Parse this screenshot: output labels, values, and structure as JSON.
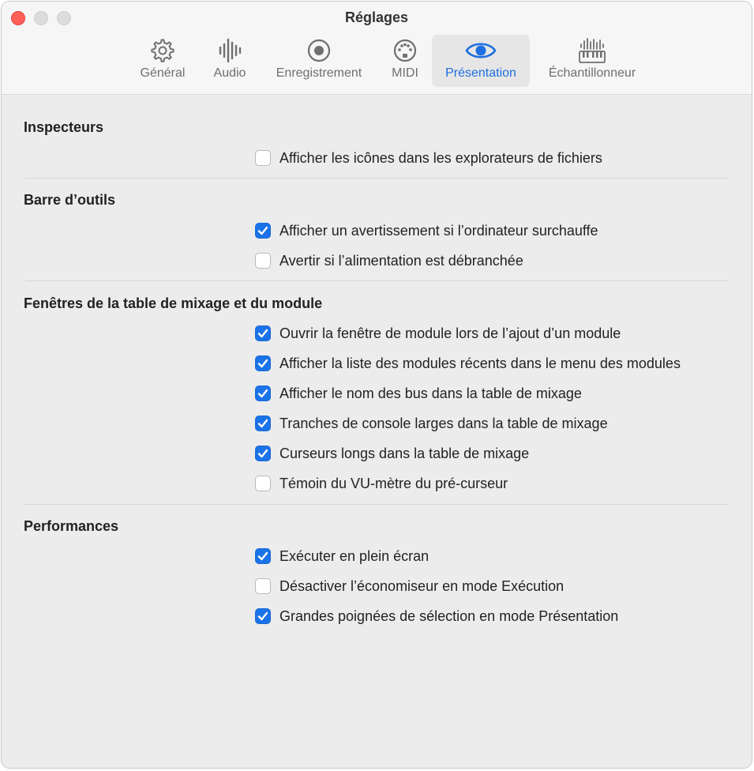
{
  "window": {
    "title": "Réglages"
  },
  "toolbar": {
    "tabs": [
      {
        "label": "Général",
        "icon": "gear-icon",
        "active": false
      },
      {
        "label": "Audio",
        "icon": "waveform-icon",
        "active": false
      },
      {
        "label": "Enregistrement",
        "icon": "record-icon",
        "active": false
      },
      {
        "label": "MIDI",
        "icon": "midi-port-icon",
        "active": false
      },
      {
        "label": "Présentation",
        "icon": "eye-icon",
        "active": true
      },
      {
        "label": "Échantillonneur",
        "icon": "sampler-keyboard-icon",
        "active": false
      }
    ]
  },
  "accent_color": "#1a73e8",
  "sections": [
    {
      "title": "Inspecteurs",
      "options": [
        {
          "label": "Afficher les icônes dans les explorateurs de fichiers",
          "checked": false
        }
      ]
    },
    {
      "title": "Barre d’outils",
      "options": [
        {
          "label": "Afficher un avertissement si l’ordinateur surchauffe",
          "checked": true
        },
        {
          "label": "Avertir si l’alimentation est débranchée",
          "checked": false
        }
      ]
    },
    {
      "title": "Fenêtres de la table de mixage et du module",
      "options": [
        {
          "label": "Ouvrir la fenêtre de module lors de l’ajout d’un module",
          "checked": true
        },
        {
          "label": "Afficher la liste des modules récents dans le menu des modules",
          "checked": true
        },
        {
          "label": "Afficher le nom des bus dans la table de mixage",
          "checked": true
        },
        {
          "label": "Tranches de console larges dans la table de mixage",
          "checked": true
        },
        {
          "label": "Curseurs longs dans la table de mixage",
          "checked": true
        },
        {
          "label": "Témoin du VU-mètre du pré-curseur",
          "checked": false
        }
      ]
    },
    {
      "title": "Performances",
      "options": [
        {
          "label": "Exécuter en plein écran",
          "checked": true
        },
        {
          "label": "Désactiver l’économiseur en mode Exécution",
          "checked": false
        },
        {
          "label": "Grandes poignées de sélection en mode Présentation",
          "checked": true
        }
      ]
    }
  ]
}
